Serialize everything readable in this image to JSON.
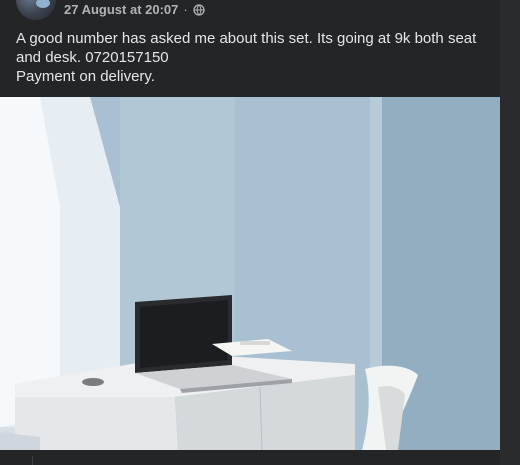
{
  "post": {
    "timestamp": "27 August at 20:07",
    "separator": "·",
    "audience_icon": "globe-icon",
    "more_icon": "more-options-icon",
    "text_line1": "A good number has asked me about this set. Its going at 9k  both seat and desk. 0720157150",
    "text_line2": "Payment on delivery.",
    "photo": "photo-desk-and-chair"
  },
  "colors": {
    "background": "#242526",
    "text": "#e4e6eb",
    "meta_text": "#b0b3b8",
    "wall": "#a9c1d2"
  }
}
